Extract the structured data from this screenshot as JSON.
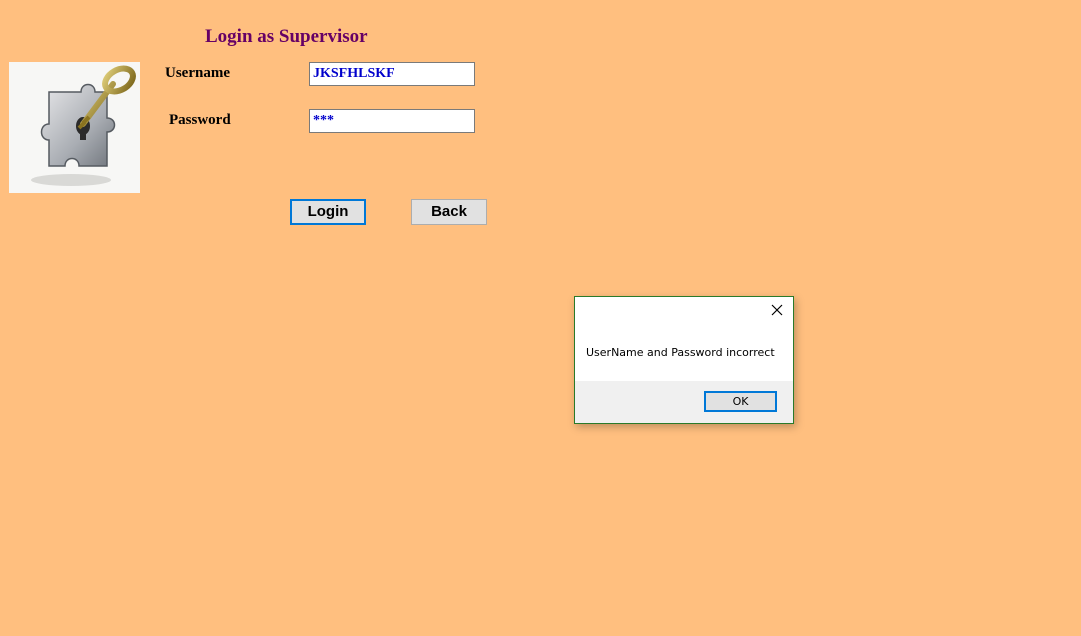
{
  "page": {
    "title": "Login as Supervisor",
    "background_color": "#FFBF7F",
    "title_color": "#660066"
  },
  "logo": {
    "icon": "key-in-puzzle-icon"
  },
  "form": {
    "username_label": "Username",
    "username_value": "JKSFHLSKF",
    "password_label": "Password",
    "password_value": "***",
    "value_color": "#0000CC"
  },
  "buttons": {
    "login_label": "Login",
    "back_label": "Back"
  },
  "dialog": {
    "message": "UserName and Password incorrect",
    "ok_label": "OK",
    "close_icon": "close-icon"
  }
}
